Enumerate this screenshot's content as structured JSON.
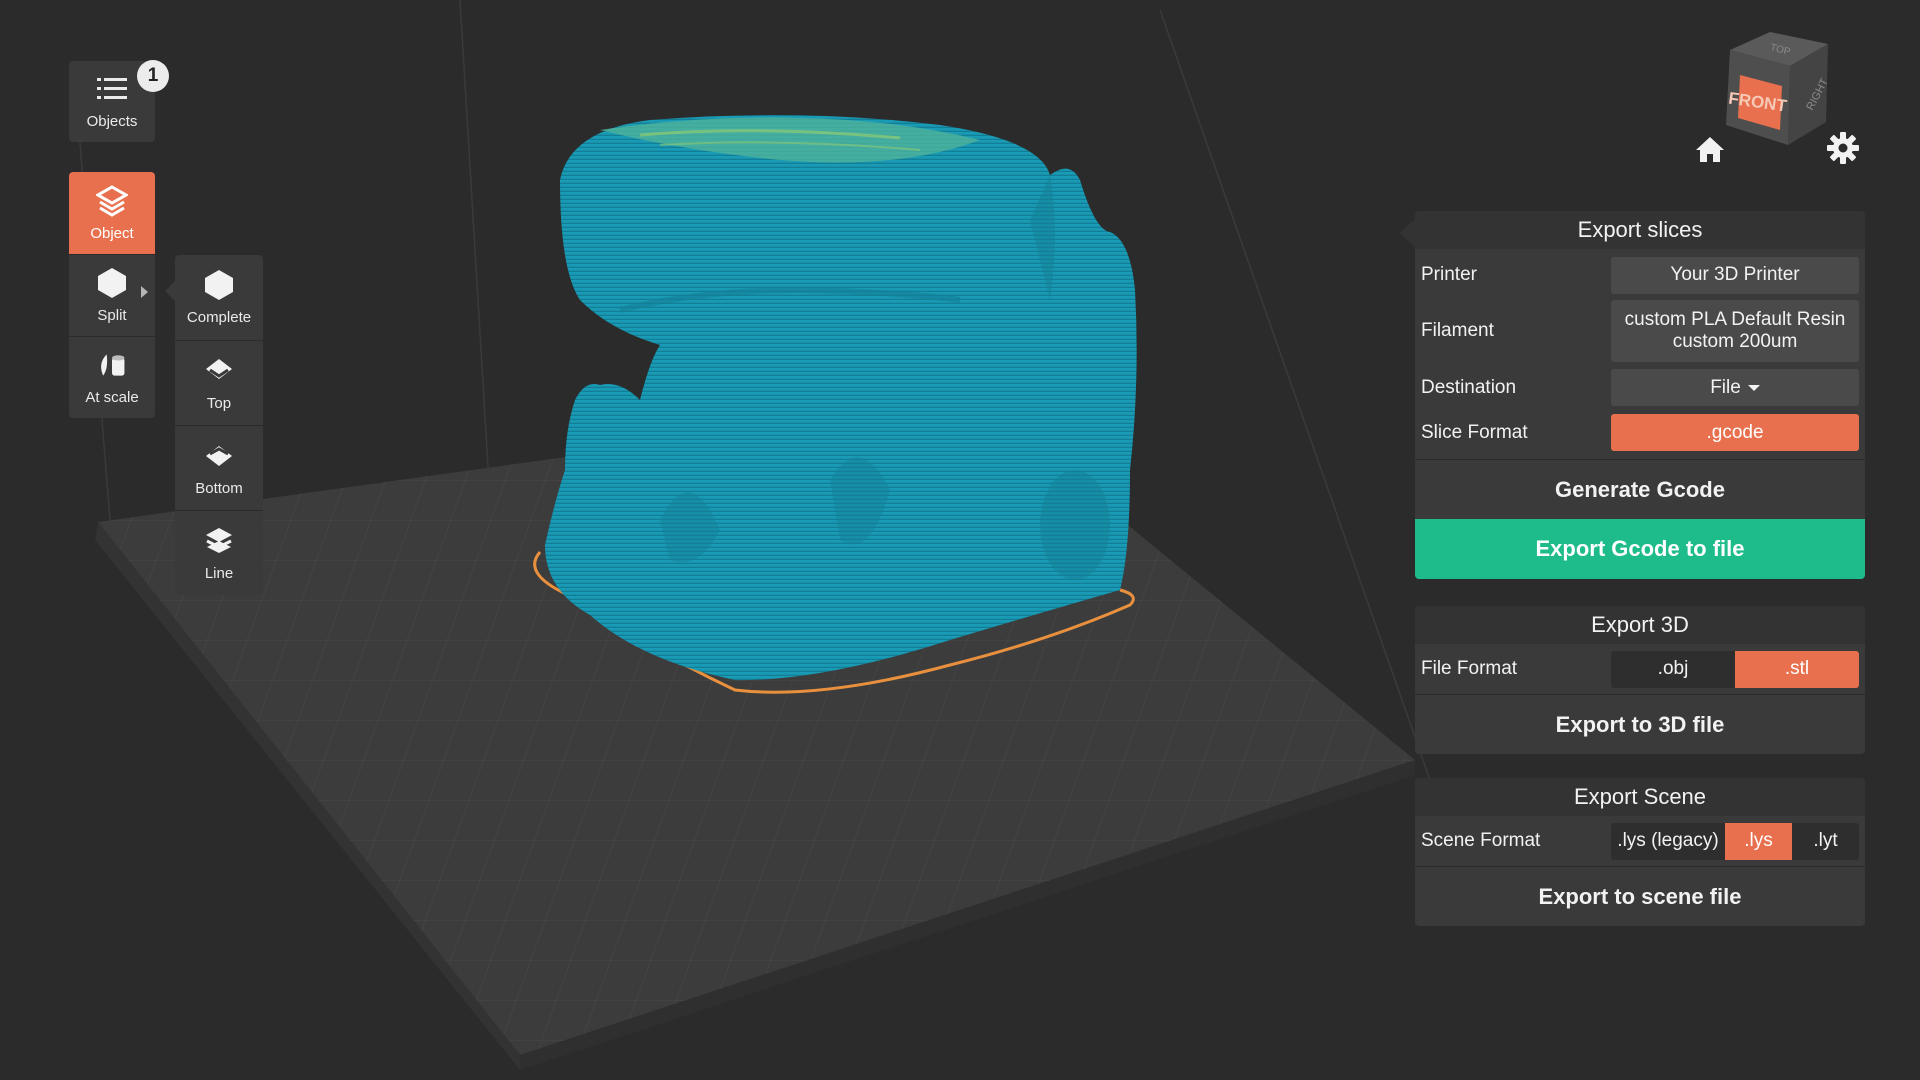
{
  "toolbar": {
    "objects_label": "Objects",
    "objects_count": "1",
    "object_label": "Object",
    "split_label": "Split",
    "atscale_label": "At scale"
  },
  "split_menu": {
    "complete_label": "Complete",
    "top_label": "Top",
    "bottom_label": "Bottom",
    "line_label": "Line"
  },
  "view_cube": {
    "front": "FRONT",
    "right": "RIGHT",
    "top": "TOP"
  },
  "export_slices": {
    "title": "Export slices",
    "printer_label": "Printer",
    "printer_value": "Your 3D Printer",
    "filament_label": "Filament",
    "filament_line1": "custom PLA Default Resin",
    "filament_line2": "custom 200um",
    "destination_label": "Destination",
    "destination_value": "File",
    "slice_format_label": "Slice Format",
    "slice_format_value": ".gcode",
    "generate_button": "Generate Gcode",
    "export_button": "Export Gcode to file"
  },
  "export_3d": {
    "title": "Export 3D",
    "file_format_label": "File Format",
    "options": [
      ".obj",
      ".stl"
    ],
    "selected": ".stl",
    "export_button": "Export to 3D file"
  },
  "export_scene": {
    "title": "Export Scene",
    "scene_format_label": "Scene Format",
    "options": [
      ".lys (legacy)",
      ".lys",
      ".lyt"
    ],
    "selected": ".lys",
    "export_button": "Export to scene file"
  },
  "colors": {
    "accent_orange": "#e8704e",
    "accent_green": "#1ebc8a",
    "model_blue": "#1a9bb5",
    "panel_bg": "#3a3a3a",
    "background": "#2b2b2b"
  }
}
